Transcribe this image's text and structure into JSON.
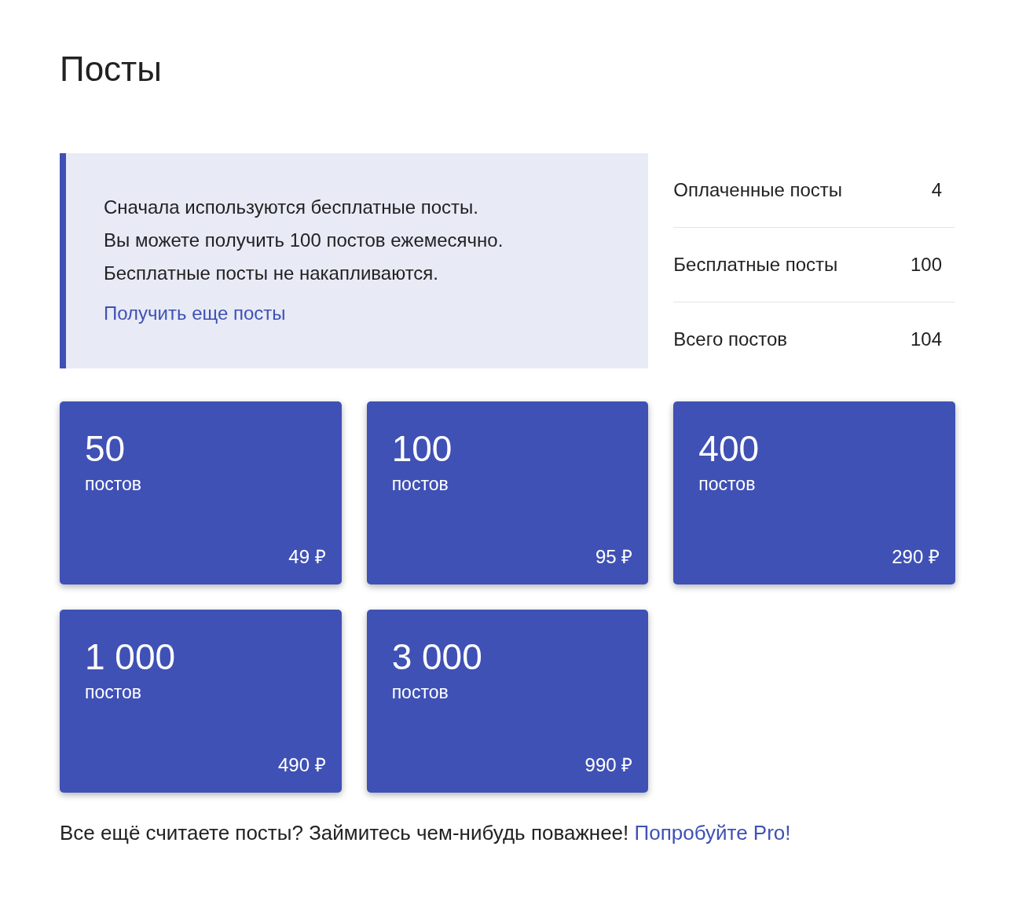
{
  "title": "Посты",
  "info": {
    "lines": [
      "Сначала используются бесплатные посты.",
      "Вы можете получить 100 постов ежемесячно.",
      "Бесплатные посты не накапливаются."
    ],
    "link": "Получить еще посты"
  },
  "stats": [
    {
      "label": "Оплаченные посты",
      "value": "4"
    },
    {
      "label": "Бесплатные посты",
      "value": "100"
    },
    {
      "label": "Всего постов",
      "value": "104"
    }
  ],
  "packages": [
    {
      "count": "50",
      "unit": "постов",
      "price": "49 ₽"
    },
    {
      "count": "100",
      "unit": "постов",
      "price": "95 ₽"
    },
    {
      "count": "400",
      "unit": "постов",
      "price": "290 ₽"
    },
    {
      "count": "1 000",
      "unit": "постов",
      "price": "490 ₽"
    },
    {
      "count": "3 000",
      "unit": "постов",
      "price": "990 ₽"
    }
  ],
  "footer": {
    "text": "Все ещё считаете посты? Займитесь чем-нибудь поважнее!",
    "link": "Попробуйте Pro!"
  }
}
